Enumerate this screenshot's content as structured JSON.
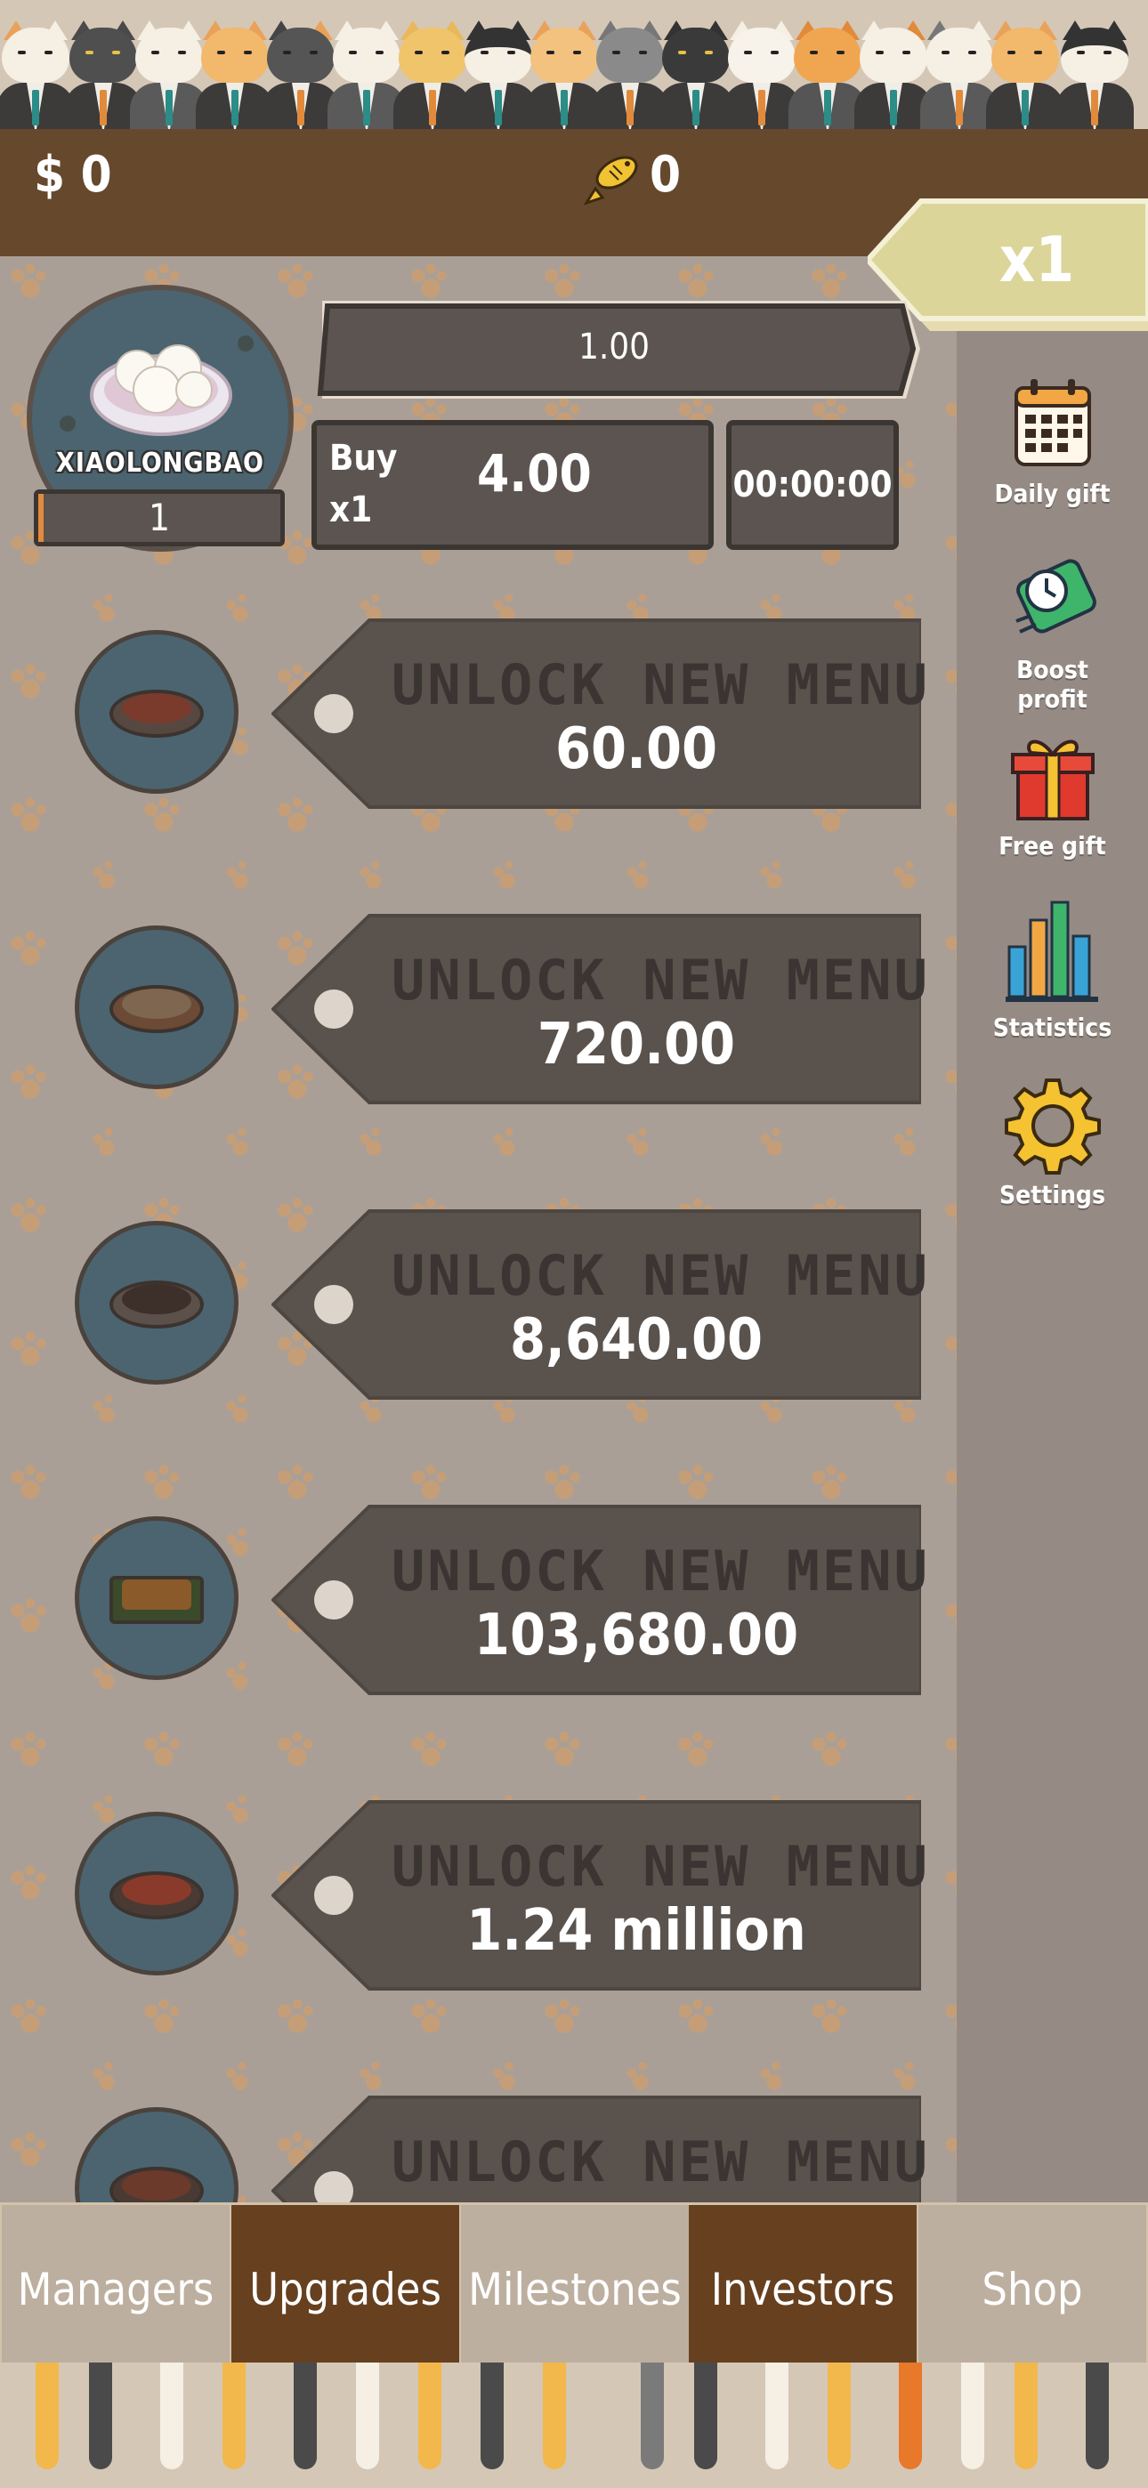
{
  "header": {
    "money": "$ 0",
    "fish_count": "0"
  },
  "multiplier": {
    "label": "x1"
  },
  "featured": {
    "name": "XIAOLONGBAO",
    "level": "1",
    "progress_value": "1.00",
    "buy_label_line1": "Buy",
    "buy_label_line2": "x1",
    "buy_price": "4.00",
    "timer": "00:00:00"
  },
  "menu": [
    {
      "title": "UNLOCK NEW MENU",
      "price": "60.00"
    },
    {
      "title": "UNLOCK NEW MENU",
      "price": "720.00"
    },
    {
      "title": "UNLOCK NEW MENU",
      "price": "8,640.00"
    },
    {
      "title": "UNLOCK NEW MENU",
      "price": "103,680.00"
    },
    {
      "title": "UNLOCK NEW MENU",
      "price": "1.24 million"
    },
    {
      "title": "UNLOCK NEW MENU",
      "price": ""
    }
  ],
  "sidebar": [
    {
      "label": "Daily gift",
      "icon": "calendar-icon"
    },
    {
      "label": "Boost profit",
      "icon": "boost-clock-icon"
    },
    {
      "label": "Free gift",
      "icon": "gift-icon"
    },
    {
      "label": "Statistics",
      "icon": "bar-chart-icon"
    },
    {
      "label": "Settings",
      "icon": "gear-icon"
    }
  ],
  "tabs": [
    {
      "label": "Managers"
    },
    {
      "label": "Upgrades"
    },
    {
      "label": "Milestones"
    },
    {
      "label": "Investors"
    },
    {
      "label": "Shop"
    }
  ],
  "colors": {
    "header_brown": "#66482c",
    "dish_circle_blue": "#4b6470",
    "tag_dark": "#5b5450",
    "accent_orange": "#e28a3b"
  }
}
